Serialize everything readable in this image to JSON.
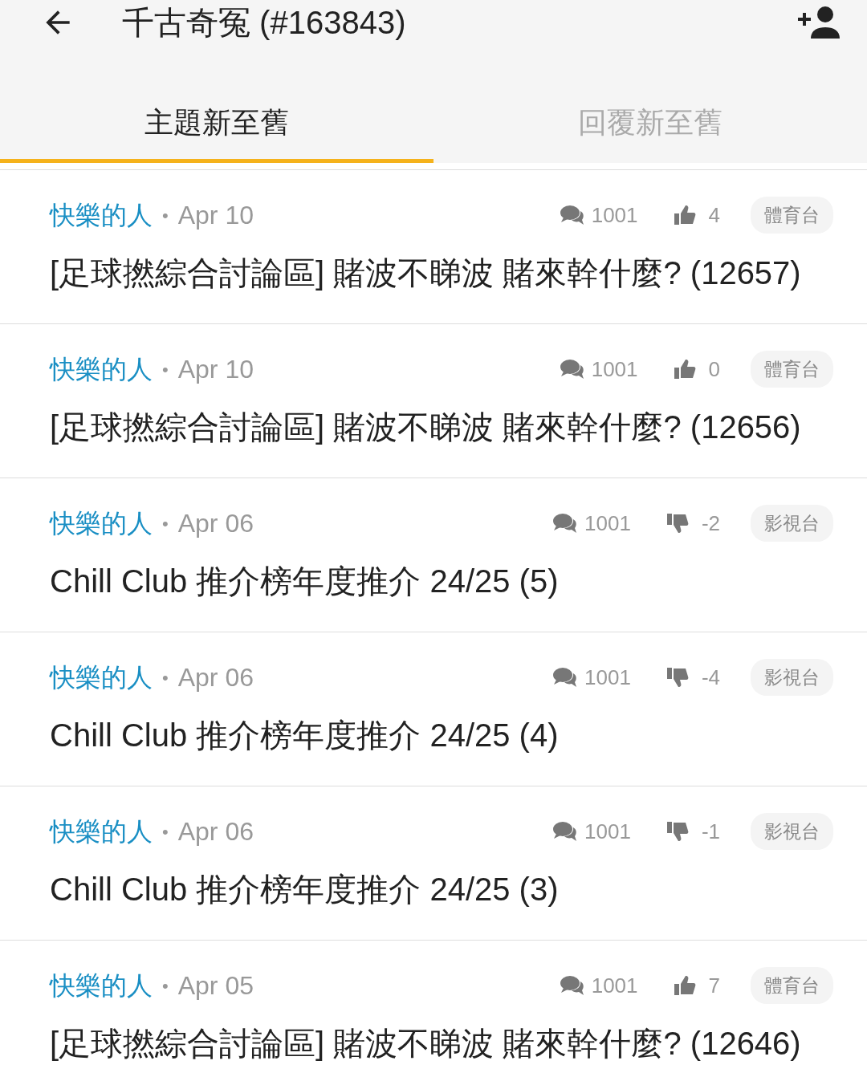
{
  "header": {
    "title": "千古奇冤 (#163843)"
  },
  "tabs": [
    {
      "label": "主題新至舊",
      "selected": true
    },
    {
      "label": "回覆新至舊",
      "selected": false
    }
  ],
  "threads": [
    {
      "author": "快樂的人",
      "separator": "•",
      "date": "Apr 10",
      "replies": "1001",
      "kind": "up",
      "score": "4",
      "tag": "體育台",
      "title": "[足球撚綜合討論區] 賭波不睇波 賭來幹什麼? (12657)"
    },
    {
      "author": "快樂的人",
      "separator": "•",
      "date": "Apr 10",
      "replies": "1001",
      "kind": "up",
      "score": "0",
      "tag": "體育台",
      "title": "[足球撚綜合討論區] 賭波不睇波 賭來幹什麼? (12656)"
    },
    {
      "author": "快樂的人",
      "separator": "•",
      "date": "Apr 06",
      "replies": "1001",
      "kind": "down",
      "score": "-2",
      "tag": "影視台",
      "title": "Chill Club 推介榜年度推介 24/25 (5)"
    },
    {
      "author": "快樂的人",
      "separator": "•",
      "date": "Apr 06",
      "replies": "1001",
      "kind": "down",
      "score": "-4",
      "tag": "影視台",
      "title": "Chill Club 推介榜年度推介 24/25 (4)"
    },
    {
      "author": "快樂的人",
      "separator": "•",
      "date": "Apr 06",
      "replies": "1001",
      "kind": "down",
      "score": "-1",
      "tag": "影視台",
      "title": "Chill Club 推介榜年度推介 24/25 (3)"
    },
    {
      "author": "快樂的人",
      "separator": "•",
      "date": "Apr 05",
      "replies": "1001",
      "kind": "up",
      "score": "7",
      "tag": "體育台",
      "title": "[足球撚綜合討論區] 賭波不睇波 賭來幹什麼? (12646)"
    }
  ]
}
